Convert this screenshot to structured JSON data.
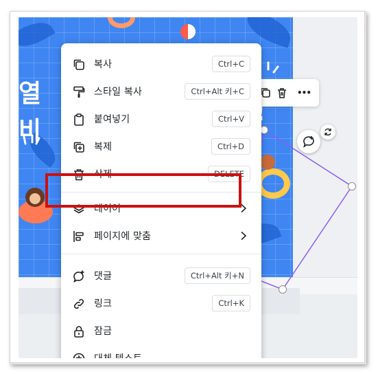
{
  "menu": {
    "items": [
      {
        "label": "복사",
        "shortcut": "Ctrl+C",
        "icon": "copy-icon"
      },
      {
        "label": "스타일 복사",
        "shortcut": "Ctrl+Alt 키+C",
        "icon": "paint-roller-icon"
      },
      {
        "label": "붙여넣기",
        "shortcut": "Ctrl+V",
        "icon": "clipboard-icon"
      },
      {
        "label": "복제",
        "shortcut": "Ctrl+D",
        "icon": "duplicate-icon"
      },
      {
        "label": "삭제",
        "shortcut": "DELETE",
        "icon": "trash-icon"
      },
      {
        "label": "레이어",
        "shortcut": "",
        "icon": "layers-icon"
      },
      {
        "label": "페이지에 맞춤",
        "shortcut": "",
        "icon": "align-icon"
      },
      {
        "label": "댓글",
        "shortcut": "Ctrl+Alt 키+N",
        "icon": "comment-add-icon"
      },
      {
        "label": "링크",
        "shortcut": "Ctrl+K",
        "icon": "link-icon"
      },
      {
        "label": "잠금",
        "shortcut": "",
        "icon": "lock-icon"
      },
      {
        "label": "대체 텍스트",
        "shortcut": "",
        "icon": "accessibility-icon"
      }
    ]
  },
  "toolbar": {
    "icons": [
      "duplicate-icon",
      "trash-icon",
      "more-icon"
    ],
    "more_label": "•••"
  },
  "canvas": {
    "text_fragments": [
      "열",
      "비",
      "!"
    ]
  },
  "colors": {
    "highlight": "#cc1010",
    "selection": "#8a5cf6",
    "canvas_bg": "#3f86f2"
  }
}
